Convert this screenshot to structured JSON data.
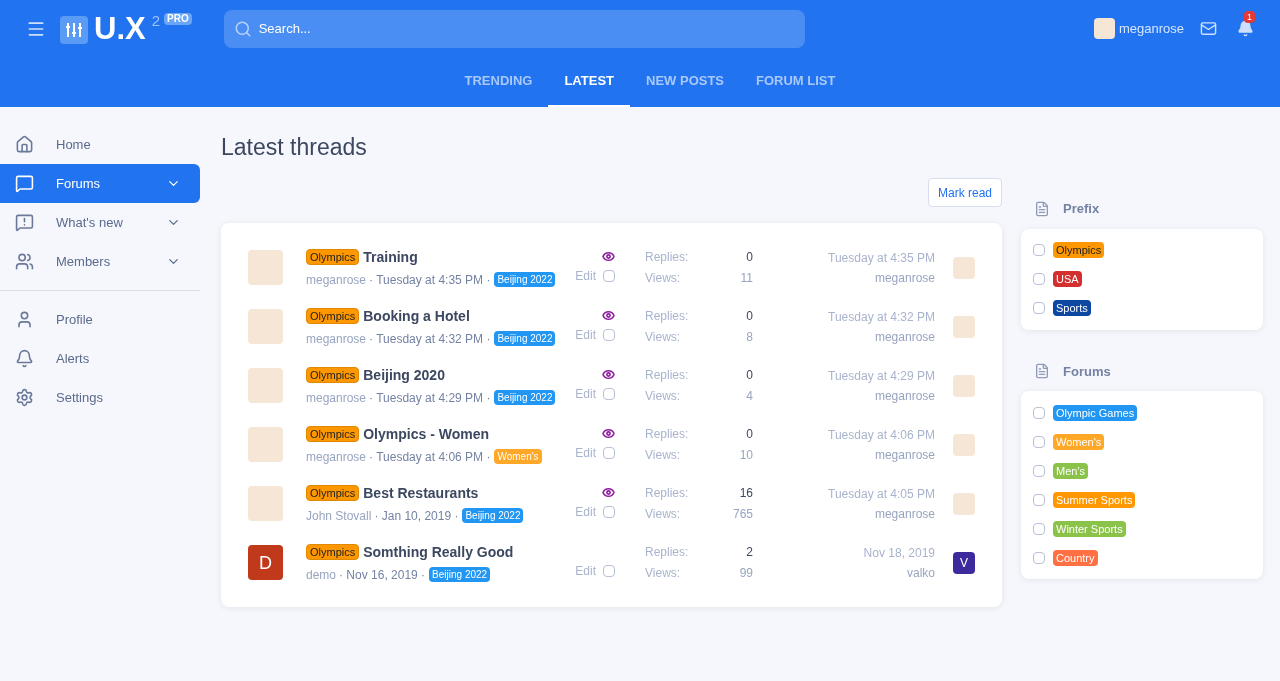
{
  "header": {
    "logo": {
      "text": "U.X",
      "superscript": "2",
      "badge": "PRO"
    },
    "search": {
      "placeholder": "Search..."
    },
    "user": {
      "name": "meganrose"
    },
    "alerts": {
      "count": "1"
    }
  },
  "tabs": [
    {
      "label": "TRENDING",
      "selected": false
    },
    {
      "label": "LATEST",
      "selected": true
    },
    {
      "label": "NEW POSTS",
      "selected": false
    },
    {
      "label": "FORUM LIST",
      "selected": false
    }
  ],
  "sidebar": {
    "groups": [
      [
        {
          "label": "Home",
          "selected": false,
          "expandable": false
        },
        {
          "label": "Forums",
          "selected": true,
          "expandable": true
        },
        {
          "label": "What's new",
          "selected": false,
          "expandable": true
        },
        {
          "label": "Members",
          "selected": false,
          "expandable": true
        }
      ],
      [
        {
          "label": "Profile",
          "selected": false,
          "expandable": false
        },
        {
          "label": "Alerts",
          "selected": false,
          "expandable": false
        },
        {
          "label": "Settings",
          "selected": false,
          "expandable": false
        }
      ]
    ]
  },
  "page": {
    "title": "Latest threads",
    "mark_read": "Mark read"
  },
  "threads": [
    {
      "prefix": "Olympics",
      "title": "Training",
      "author": "meganrose",
      "date": "· Tuesday at 4:35 PM ·",
      "forum": {
        "label": "Beijing 2022",
        "color": "#2196f3"
      },
      "watched": true,
      "edit": "Edit",
      "checked": false,
      "replies_label": "Replies:",
      "replies": "0",
      "views_label": "Views:",
      "views": "11",
      "last_date": "Tuesday at 4:35 PM",
      "last_user": "meganrose",
      "avatar": {
        "kind": "photo"
      },
      "last_avatar": {
        "kind": "photo"
      }
    },
    {
      "prefix": "Olympics",
      "title": "Booking a Hotel",
      "author": "meganrose",
      "date": "· Tuesday at 4:32 PM ·",
      "forum": {
        "label": "Beijing 2022",
        "color": "#2196f3"
      },
      "watched": true,
      "edit": "Edit",
      "checked": false,
      "replies_label": "Replies:",
      "replies": "0",
      "views_label": "Views:",
      "views": "8",
      "last_date": "Tuesday at 4:32 PM",
      "last_user": "meganrose",
      "avatar": {
        "kind": "photo"
      },
      "last_avatar": {
        "kind": "photo"
      }
    },
    {
      "prefix": "Olympics",
      "title": "Beijing 2020",
      "author": "meganrose",
      "date": "· Tuesday at 4:29 PM ·",
      "forum": {
        "label": "Beijing 2022",
        "color": "#2196f3"
      },
      "watched": true,
      "edit": "Edit",
      "checked": false,
      "replies_label": "Replies:",
      "replies": "0",
      "views_label": "Views:",
      "views": "4",
      "last_date": "Tuesday at 4:29 PM",
      "last_user": "meganrose",
      "avatar": {
        "kind": "photo"
      },
      "last_avatar": {
        "kind": "photo"
      }
    },
    {
      "prefix": "Olympics",
      "title": "Olympics - Women",
      "author": "meganrose",
      "date": "· Tuesday at 4:06 PM ·",
      "forum": {
        "label": "Women's",
        "color": "#ffa726"
      },
      "watched": true,
      "edit": "Edit",
      "checked": false,
      "replies_label": "Replies:",
      "replies": "0",
      "views_label": "Views:",
      "views": "10",
      "last_date": "Tuesday at 4:06 PM",
      "last_user": "meganrose",
      "avatar": {
        "kind": "photo"
      },
      "last_avatar": {
        "kind": "photo"
      }
    },
    {
      "prefix": "Olympics",
      "title": "Best Restaurants",
      "author": "John Stovall",
      "date": "· Jan 10, 2019 ·",
      "forum": {
        "label": "Beijing 2022",
        "color": "#2196f3"
      },
      "watched": true,
      "edit": "Edit",
      "checked": false,
      "replies_label": "Replies:",
      "replies": "16",
      "views_label": "Views:",
      "views": "765",
      "last_date": "Tuesday at 4:05 PM",
      "last_user": "meganrose",
      "avatar": {
        "kind": "photo"
      },
      "last_avatar": {
        "kind": "photo"
      }
    },
    {
      "prefix": "Olympics",
      "title": "Somthing Really Good",
      "author": "demo",
      "date": "· Nov 16, 2019 ·",
      "forum": {
        "label": "Beijing 2022",
        "color": "#2196f3"
      },
      "watched": false,
      "edit": "Edit",
      "checked": false,
      "replies_label": "Replies:",
      "replies": "2",
      "views_label": "Views:",
      "views": "99",
      "last_date": "Nov 18, 2019",
      "last_user": "valko",
      "avatar": {
        "kind": "letter",
        "letter": "D",
        "color": "#c0391b"
      },
      "last_avatar": {
        "kind": "letter",
        "letter": "V",
        "color": "#3d2b9e"
      }
    }
  ],
  "filters": [
    {
      "title": "Prefix",
      "items": [
        {
          "label": "Olympics",
          "color": "#ff9800",
          "text_dark": true,
          "checked": false
        },
        {
          "label": "USA",
          "color": "#d32f2f",
          "text_dark": false,
          "checked": false
        },
        {
          "label": "Sports",
          "color": "#0d47a1",
          "text_dark": false,
          "checked": false
        }
      ]
    },
    {
      "title": "Forums",
      "items": [
        {
          "label": "Olympic Games",
          "color": "#2196f3",
          "text_dark": false,
          "checked": false
        },
        {
          "label": "Women's",
          "color": "#ffa726",
          "text_dark": false,
          "checked": false
        },
        {
          "label": "Men's",
          "color": "#8bc34a",
          "text_dark": false,
          "checked": false
        },
        {
          "label": "Summer Sports",
          "color": "#ff9800",
          "text_dark": false,
          "checked": false
        },
        {
          "label": "Winter Sports",
          "color": "#8bc34a",
          "text_dark": false,
          "checked": false
        },
        {
          "label": "Country",
          "color": "#ff7043",
          "text_dark": false,
          "checked": false
        }
      ]
    }
  ]
}
